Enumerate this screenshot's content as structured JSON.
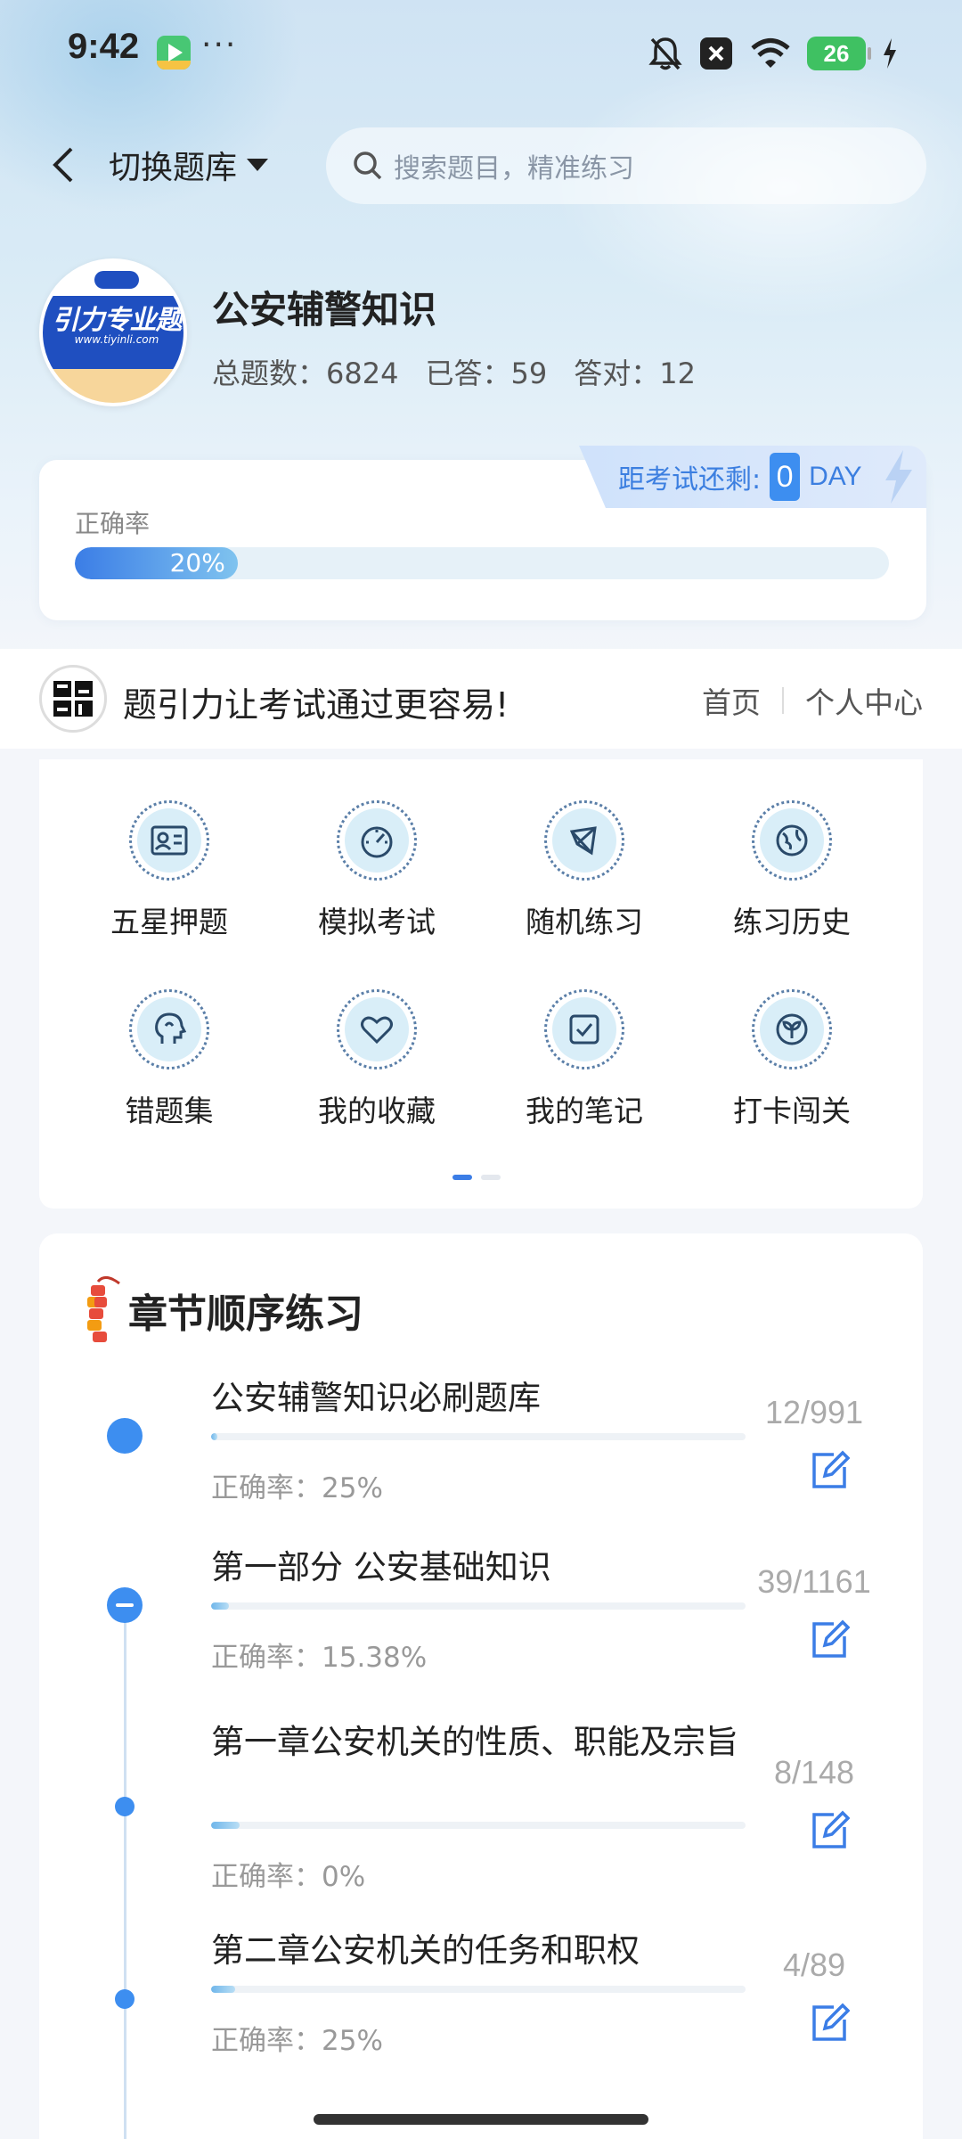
{
  "status_bar": {
    "time": "9:42",
    "more": "···",
    "battery": "26"
  },
  "header": {
    "switch_label": "切换题库",
    "search_placeholder": "搜索题目，精准练习"
  },
  "profile": {
    "logo_text": "引力专业题",
    "logo_url": "www.tiyinli.com",
    "title": "公安辅警知识",
    "total_label": "总题数：",
    "total": "6824",
    "answered_label": "已答：",
    "answered": "59",
    "correct_label": "答对：",
    "correct": "12"
  },
  "accuracy": {
    "label": "正确率",
    "value": "20%",
    "fraction": 0.2,
    "countdown_label": "距考试还剩:",
    "countdown_value": "0",
    "countdown_unit": "DAY"
  },
  "slogan": {
    "logo_text": "题引力",
    "text": "题引力让考试通过更容易!",
    "nav_home": "首页",
    "nav_profile": "个人中心"
  },
  "grid": {
    "items": [
      {
        "label": "五星押题",
        "icon": "id-card-icon"
      },
      {
        "label": "模拟考试",
        "icon": "speedometer-icon"
      },
      {
        "label": "随机练习",
        "icon": "shuffle-icon"
      },
      {
        "label": "练习历史",
        "icon": "globe-icon"
      },
      {
        "label": "错题集",
        "icon": "head-icon"
      },
      {
        "label": "我的收藏",
        "icon": "heart-icon"
      },
      {
        "label": "我的笔记",
        "icon": "note-check-icon"
      },
      {
        "label": "打卡闯关",
        "icon": "sprout-icon"
      }
    ],
    "pages": 2,
    "active_page": 0
  },
  "chapters": {
    "title": "章节顺序练习",
    "items": [
      {
        "name": "公安辅警知识必刷题库",
        "rate": "正确率：25%",
        "count": "12/991",
        "progress": 0.012
      },
      {
        "name": "第一部分 公安基础知识",
        "rate": "正确率：15.38%",
        "count": "39/1161",
        "progress": 0.034
      },
      {
        "name": "第一章公安机关的性质、职能及宗旨",
        "rate": "正确率：0%",
        "count": "8/148",
        "progress": 0.054
      },
      {
        "name": "第二章公安机关的任务和职权",
        "rate": "正确率：25%",
        "count": "4/89",
        "progress": 0.045
      }
    ]
  },
  "colors": {
    "accent": "#3b7de6",
    "node": "#3d8ef0"
  }
}
